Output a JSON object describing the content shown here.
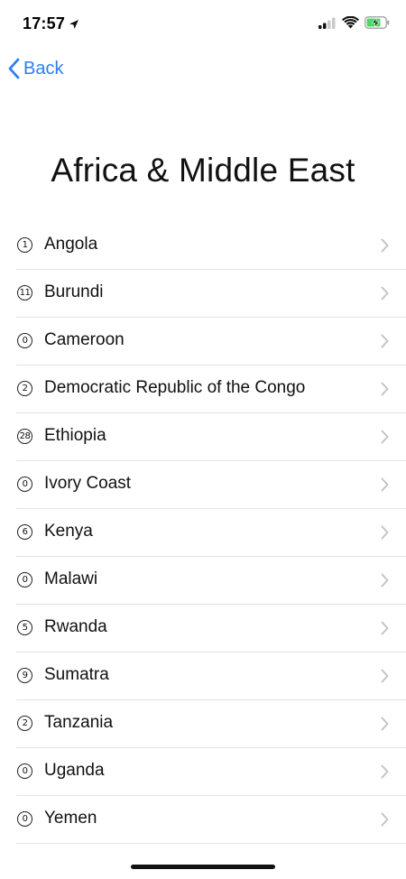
{
  "status_bar": {
    "time": "17:57",
    "location_icon": "location-arrow-icon",
    "signal_icon": "cellular-signal-icon",
    "wifi_icon": "wifi-icon",
    "battery_icon": "battery-charging-icon",
    "battery_color": "#4cd964"
  },
  "nav": {
    "back_label": "Back",
    "back_icon": "chevron-left-icon",
    "accent_color": "#2f7cf6"
  },
  "page": {
    "title": "Africa & Middle East"
  },
  "list": {
    "chevron_icon": "chevron-right-icon",
    "items": [
      {
        "count": "1",
        "label": "Angola"
      },
      {
        "count": "11",
        "label": "Burundi"
      },
      {
        "count": "0",
        "label": "Cameroon"
      },
      {
        "count": "2",
        "label": "Democratic Republic of the Congo"
      },
      {
        "count": "28",
        "label": "Ethiopia"
      },
      {
        "count": "0",
        "label": "Ivory Coast"
      },
      {
        "count": "6",
        "label": "Kenya"
      },
      {
        "count": "0",
        "label": "Malawi"
      },
      {
        "count": "5",
        "label": "Rwanda"
      },
      {
        "count": "9",
        "label": "Sumatra"
      },
      {
        "count": "2",
        "label": "Tanzania"
      },
      {
        "count": "0",
        "label": "Uganda"
      },
      {
        "count": "0",
        "label": "Yemen"
      }
    ]
  }
}
